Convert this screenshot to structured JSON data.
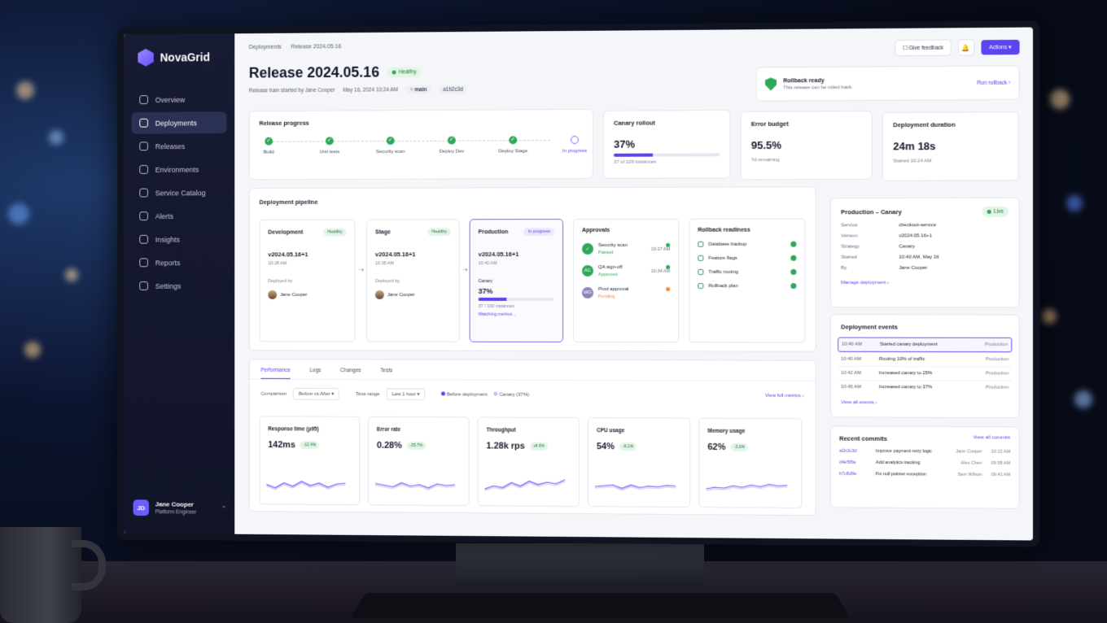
{
  "app": {
    "name": "NovaGrid"
  },
  "sidebar": {
    "items": [
      {
        "label": "Overview",
        "icon": "home-icon"
      },
      {
        "label": "Deployments",
        "icon": "gear-icon"
      },
      {
        "label": "Releases",
        "icon": "box-icon"
      },
      {
        "label": "Environments",
        "icon": "grid-icon"
      },
      {
        "label": "Service Catalog",
        "icon": "gear-icon"
      },
      {
        "label": "Alerts",
        "icon": "bell-icon"
      },
      {
        "label": "Insights",
        "icon": "chart-icon"
      },
      {
        "label": "Reports",
        "icon": "report-icon"
      },
      {
        "label": "Settings",
        "icon": "gear-icon"
      }
    ],
    "user": {
      "initials": "JD",
      "name": "Jane Cooper",
      "role": "Platform Engineer"
    }
  },
  "breadcrumb": [
    "Deployments",
    "Release 2024.05.16"
  ],
  "header": {
    "title": "Release 2024.05.16",
    "status": "Healthy",
    "started_by": "Release train started by Jane Cooper",
    "date": "May 16, 2024 10:24 AM",
    "branch": "main",
    "commit": "a1b2c3d",
    "feedback_label": "Give feedback",
    "actions_label": "Actions"
  },
  "rollback": {
    "title": "Rollback ready",
    "subtitle": "This release can be rolled back",
    "link": "Run rollback"
  },
  "release_progress": {
    "title": "Release progress",
    "steps": [
      "Build",
      "Unit tests",
      "Security scan",
      "Deploy Dev",
      "Deploy Stage",
      "In progress"
    ]
  },
  "stats": {
    "canary": {
      "title": "Canary rollout",
      "value": "37%",
      "sub": "37 of 100 instances",
      "progress": 0.37
    },
    "error_budget": {
      "title": "Error budget",
      "value": "95.5%",
      "sub": "7d remaining"
    },
    "duration": {
      "title": "Deployment duration",
      "value": "24m 18s",
      "sub": "Started 10:24 AM"
    }
  },
  "pipeline": {
    "title": "Deployment pipeline",
    "deployed_by_label": "Deployed by",
    "stages": [
      {
        "name": "Development",
        "badge": "Healthy",
        "version": "v2024.05.16+1",
        "time": "10:28 AM",
        "user": "Jane Cooper"
      },
      {
        "name": "Stage",
        "badge": "Healthy",
        "version": "v2024.05.16+1",
        "time": "10:35 AM",
        "user": "Jane Cooper"
      },
      {
        "name": "Production",
        "badge": "In progress",
        "version": "v2024.05.16+1",
        "time": "10:40 AM",
        "canary_label": "Canary",
        "canary_value": "37%",
        "canary_sub": "37 / 100 instances",
        "watching": "Watching metrics...",
        "progress": 0.37
      }
    ],
    "approvals": {
      "title": "Approvals",
      "items": [
        {
          "name": "Security scan",
          "status": "Passed",
          "time": "10:27 AM",
          "initials": "",
          "color": "#2fa85a"
        },
        {
          "name": "QA sign-off",
          "status": "Approved",
          "time": "10:34 AM",
          "initials": "AC",
          "color": "#2fa85a"
        },
        {
          "name": "Prod approval",
          "status": "Pending",
          "time": "",
          "initials": "MG",
          "color": "#f08a3c"
        }
      ]
    },
    "rollback_readiness": {
      "title": "Rollback readiness",
      "items": [
        "Database backup",
        "Feature flags",
        "Traffic routing",
        "Rollback plan"
      ]
    }
  },
  "metrics": {
    "tabs": [
      "Performance",
      "Logs",
      "Changes",
      "Tests"
    ],
    "comparison_label": "Comparison",
    "comparison_value": "Before vs After",
    "time_range_label": "Time range",
    "time_range_value": "Last 1 hour",
    "legend_before": "Before deployment",
    "legend_canary": "Canary (37%)",
    "view_full": "View full metrics",
    "cards": [
      {
        "title": "Response time (p95)",
        "value": "142ms",
        "delta": "-12.4%"
      },
      {
        "title": "Error rate",
        "value": "0.28%",
        "delta": "-35.7%"
      },
      {
        "title": "Throughput",
        "value": "1.28k rps",
        "delta": "+8.6%"
      },
      {
        "title": "CPU usage",
        "value": "54%",
        "delta": "-6.1%"
      },
      {
        "title": "Memory usage",
        "value": "62%",
        "delta": "-3.3%"
      }
    ]
  },
  "production_canary": {
    "title": "Production – Canary",
    "badge": "Live",
    "fields": [
      {
        "k": "Service",
        "v": "checkout-service"
      },
      {
        "k": "Version",
        "v": "v2024.05.16+1"
      },
      {
        "k": "Strategy",
        "v": "Canary"
      },
      {
        "k": "Started",
        "v": "10:40 AM, May 16"
      },
      {
        "k": "By",
        "v": "Jane Cooper"
      }
    ],
    "link": "Manage deployment"
  },
  "events": {
    "title": "Deployment events",
    "rows": [
      {
        "time": "10:40 AM",
        "msg": "Started canary deployment",
        "env": "Production"
      },
      {
        "time": "10:40 AM",
        "msg": "Routing 10% of traffic",
        "env": "Production"
      },
      {
        "time": "10:42 AM",
        "msg": "Increased canary to 25%",
        "env": "Production"
      },
      {
        "time": "10:45 AM",
        "msg": "Increased canary to 37%",
        "env": "Production"
      }
    ],
    "link": "View all events"
  },
  "commits": {
    "title": "Recent commits",
    "link": "View all commits",
    "rows": [
      {
        "hash": "a1b2c3d",
        "msg": "Improve payment retry logic",
        "author": "Jane Cooper",
        "time": "10:12 AM"
      },
      {
        "hash": "d4e5f6a",
        "msg": "Add analytics tracking",
        "author": "Alex Chen",
        "time": "09:58 AM"
      },
      {
        "hash": "b7c8d9e",
        "msg": "Fix null pointer exception",
        "author": "Sam Wilson",
        "time": "09:41 AM"
      }
    ]
  }
}
